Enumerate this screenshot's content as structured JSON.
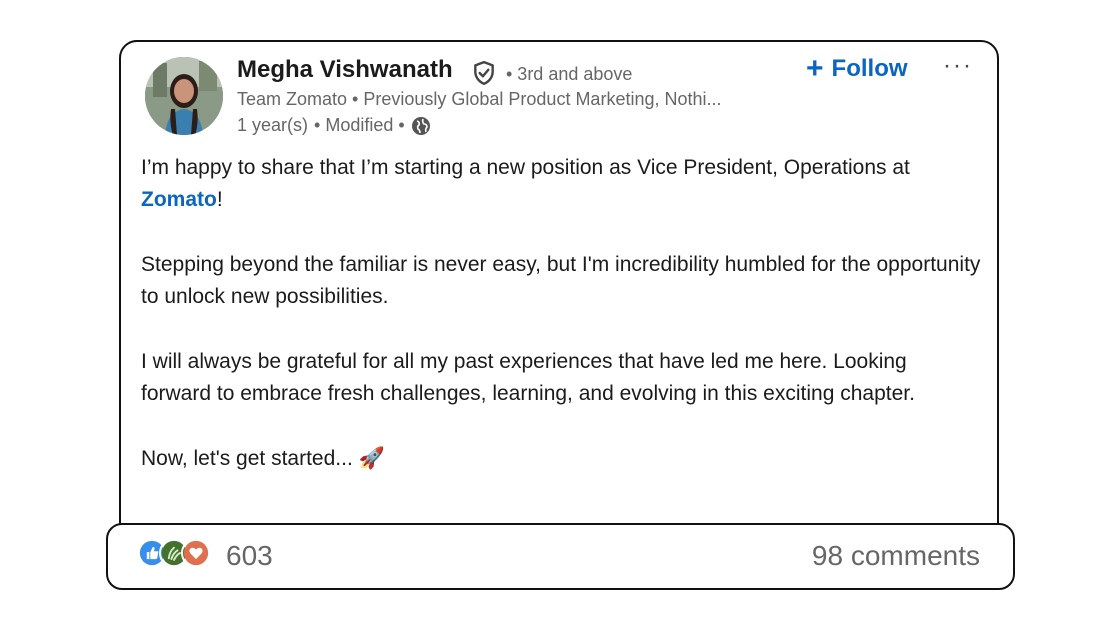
{
  "author": {
    "name": "Megha Vishwanath",
    "degree": "• 3rd and above",
    "headline": "Team Zomato • Previously Global Product Marketing, Nothi...",
    "time": "1 year(s)",
    "modified": "• Modified •",
    "verified_icon": "verified-shield-icon",
    "visibility_icon": "globe-icon"
  },
  "actions": {
    "follow_label": "Follow",
    "more_label": "···"
  },
  "post": {
    "line1_prefix": "I’m happy to share that I’m starting a new position as Vice President, Operations at ",
    "mention": "Zomato",
    "line1_suffix": "!",
    "para2": "Stepping beyond the familiar is never easy, but I'm incredibility humbled for the opportunity to unlock new possibilities.",
    "para3": "I will always be grateful for all my past experiences that have led me here. Looking forward to embrace fresh challenges, learning, and evolving in this exciting chapter.",
    "para4": "Now, let's get started... 🚀"
  },
  "social": {
    "reaction_icons": [
      "like-icon",
      "celebrate-icon",
      "love-icon"
    ],
    "reaction_count": "603",
    "comments": "98 comments"
  },
  "colors": {
    "accent": "#0a66c2",
    "muted": "#666666",
    "border": "#111111"
  }
}
